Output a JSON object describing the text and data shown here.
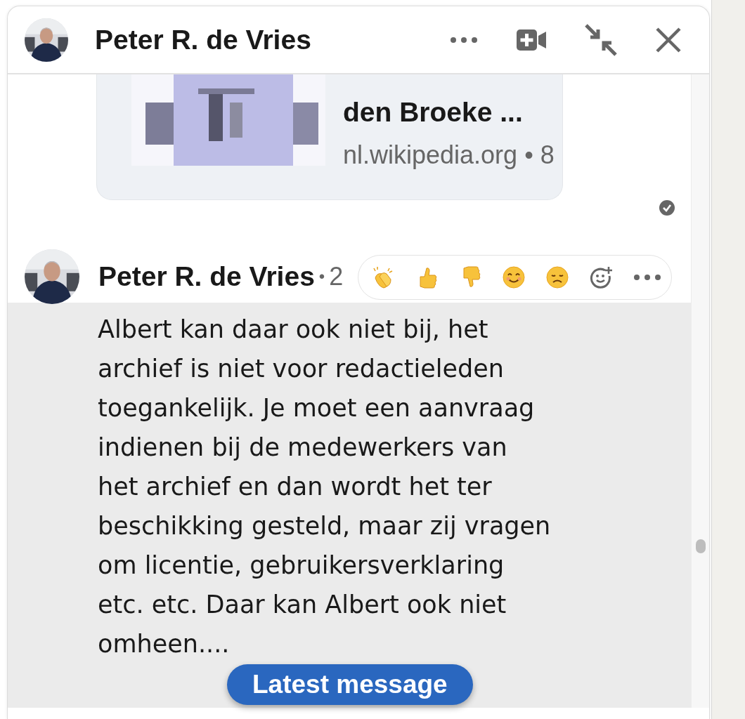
{
  "window": {
    "title": "Peter R. de Vries"
  },
  "header_actions": [
    {
      "kind": "more"
    },
    {
      "kind": "video"
    },
    {
      "kind": "minimize"
    },
    {
      "kind": "close"
    }
  ],
  "messages": [
    {
      "kind": "link_preview",
      "link": {
        "title": "den Broeke ...",
        "meta": "nl.wikipedia.org • 8"
      },
      "read": true
    },
    {
      "kind": "text",
      "sender": "Peter R. de Vries",
      "separator": "•",
      "time": "2",
      "hovered": true,
      "text": "Albert kan daar ook niet bij, het archief is niet voor redactieleden toegankelijk. Je moet een aanvraag indienen bij de medewerkers van het archief en dan wordt het ter beschikking gesteld, maar zij vragen om licentie, gebruikersverklaring etc. etc. Daar kan Albert ook niet omheen....",
      "reactions": [
        {
          "kind": "clap"
        },
        {
          "kind": "thumbs_up"
        },
        {
          "kind": "thumbs_down"
        },
        {
          "kind": "smile"
        },
        {
          "kind": "sad"
        },
        {
          "kind": "add"
        },
        {
          "kind": "more"
        }
      ]
    }
  ],
  "latest_button": "Latest message"
}
